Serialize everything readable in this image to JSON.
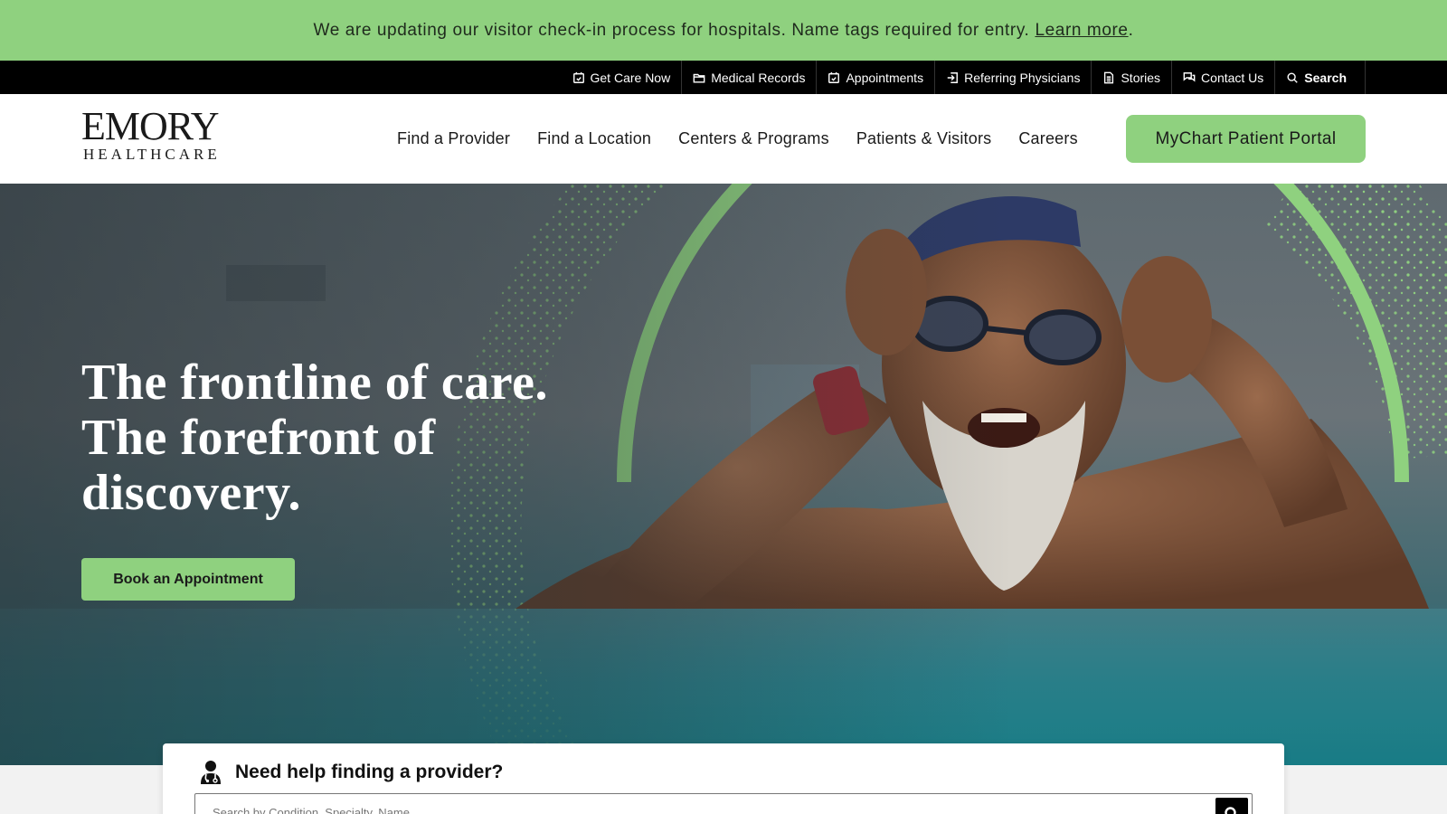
{
  "alert": {
    "message": "We are updating our visitor check-in process for hospitals. Name tags required for entry.",
    "link": "Learn more",
    "period": "."
  },
  "utility_nav": {
    "items": [
      {
        "label": "Get Care Now",
        "icon": "calendar-check-icon"
      },
      {
        "label": "Medical Records",
        "icon": "folder-icon"
      },
      {
        "label": "Appointments",
        "icon": "calendar-check-icon"
      },
      {
        "label": "Referring Physicians",
        "icon": "referral-icon"
      },
      {
        "label": "Stories",
        "icon": "document-icon"
      },
      {
        "label": "Contact Us",
        "icon": "chat-icon"
      },
      {
        "label": "Search",
        "icon": "search-icon"
      }
    ]
  },
  "logo": {
    "line1": "EMORY",
    "line2": "HEALTHCARE"
  },
  "main_nav": {
    "items": [
      "Find a Provider",
      "Find a Location",
      "Centers & Programs",
      "Patients & Visitors",
      "Careers"
    ],
    "portal_button": "MyChart Patient Portal"
  },
  "hero": {
    "headline_line1": "The frontline of care.",
    "headline_line2": "The forefront of",
    "headline_line3": "discovery.",
    "cta": "Book an Appointment"
  },
  "provider_search": {
    "title": "Need help finding a provider?",
    "placeholder": "Search by Condition, Specialty, Name",
    "icon": "doctor-icon"
  },
  "colors": {
    "brand_green": "#8fd17f",
    "utility_bar": "#000000"
  }
}
